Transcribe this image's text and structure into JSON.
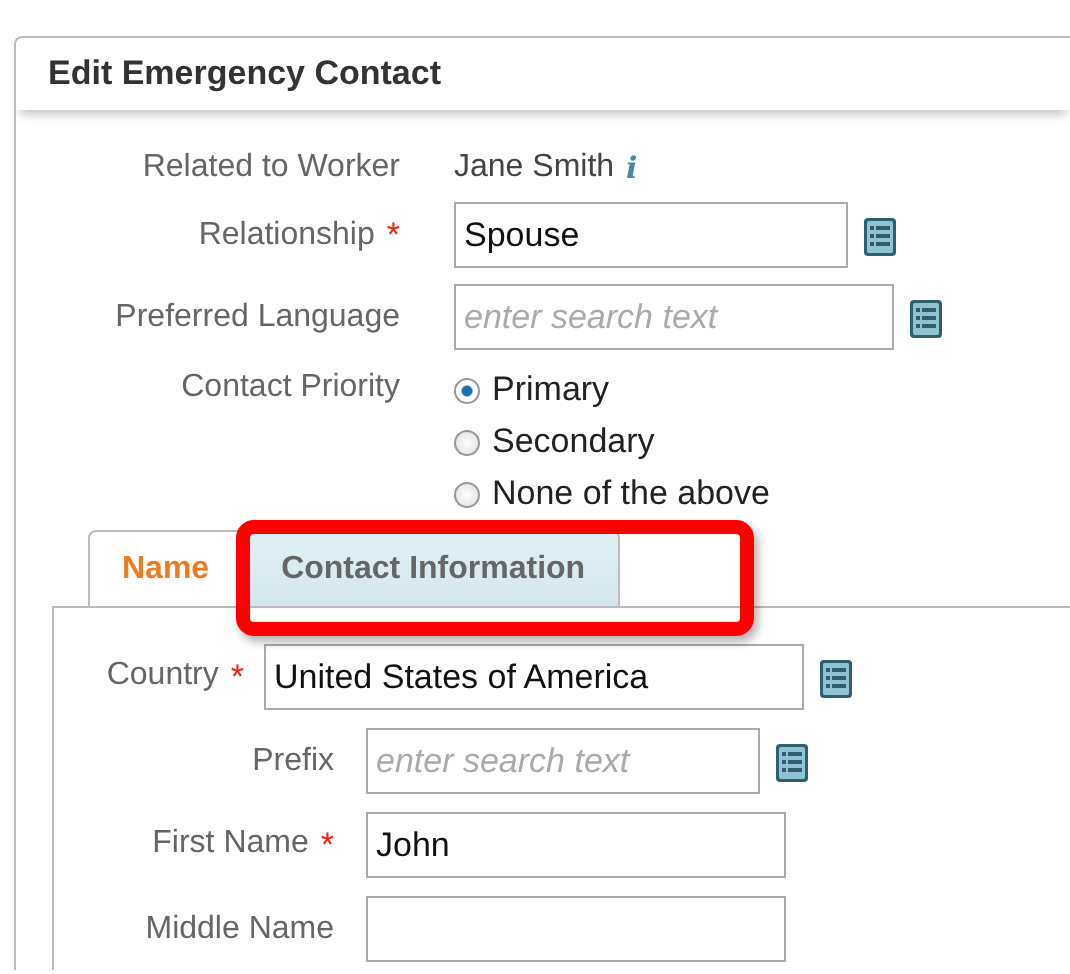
{
  "dialog": {
    "title": "Edit Emergency Contact"
  },
  "fields": [
    {
      "kind": "text",
      "label": "Related to Worker",
      "value": "Jane Smith",
      "info_icon": "i"
    },
    {
      "kind": "input",
      "label": "Relationship",
      "required_mark": "*",
      "value": "Spouse",
      "lookup": true
    },
    {
      "kind": "input",
      "label": "Preferred Language",
      "placeholder": "enter search text",
      "lookup": true
    },
    {
      "kind": "radios",
      "label": "Contact Priority",
      "options": [
        {
          "label": "Primary",
          "selected": true
        },
        {
          "label": "Secondary",
          "selected": false
        },
        {
          "label": "None of the above",
          "selected": false
        }
      ]
    }
  ],
  "tabs": [
    {
      "label": "Name",
      "selected": true
    },
    {
      "label": "Contact Information",
      "selected": false
    }
  ],
  "highlight_frame": true,
  "tab_fields": [
    {
      "label": "Country",
      "required_mark": "*",
      "value": "United States of America",
      "lookup": true
    },
    {
      "label": "Prefix",
      "placeholder": "enter search text",
      "lookup": true
    },
    {
      "label": "First Name",
      "required_mark": "*",
      "value": "John",
      "lookup": false
    },
    {
      "label": "Middle Name",
      "lookup": false
    }
  ]
}
